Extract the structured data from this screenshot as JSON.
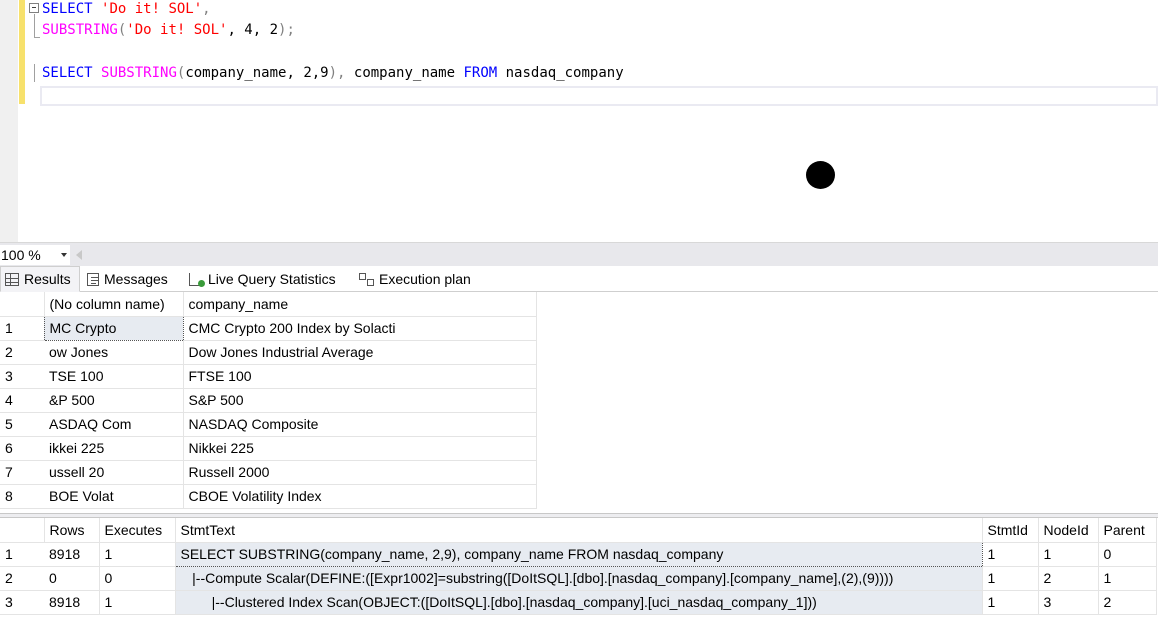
{
  "editor": {
    "lines": [
      {
        "tokens": [
          {
            "t": "SELECT",
            "c": "kw"
          },
          {
            "t": " "
          },
          {
            "t": "'Do it! SOL'",
            "c": "str"
          },
          {
            "t": ",",
            "c": "pun"
          }
        ]
      },
      {
        "tokens": [
          {
            "t": "SUBSTRING",
            "c": "fn"
          },
          {
            "t": "(",
            "c": "pun"
          },
          {
            "t": "'Do it! SOL'",
            "c": "str"
          },
          {
            "t": ", 4, 2",
            "c": ""
          },
          {
            "t": ");",
            "c": "pun"
          }
        ]
      },
      {
        "tokens": []
      },
      {
        "tokens": [
          {
            "t": "SELECT",
            "c": "kw"
          },
          {
            "t": " "
          },
          {
            "t": "SUBSTRING",
            "c": "fn"
          },
          {
            "t": "(",
            "c": "pun"
          },
          {
            "t": "company_name, 2,9"
          },
          {
            "t": "),",
            "c": "pun"
          },
          {
            "t": " company_name "
          },
          {
            "t": "FROM",
            "c": "kw"
          },
          {
            "t": " nasdaq_company"
          }
        ]
      }
    ]
  },
  "zoom": {
    "value": "100 %"
  },
  "tabs": [
    {
      "label": "Results",
      "icon": "grid-icon",
      "active": true
    },
    {
      "label": "Messages",
      "icon": "messages-icon"
    },
    {
      "label": "Live Query Statistics",
      "icon": "live-stats-icon"
    },
    {
      "label": "Execution plan",
      "icon": "execution-plan-icon"
    }
  ],
  "results": {
    "columns": [
      "(No column name)",
      "company_name"
    ],
    "rows": [
      [
        "1",
        "MC Crypto",
        "CMC Crypto 200 Index by Solacti"
      ],
      [
        "2",
        "ow Jones",
        "Dow Jones Industrial Average"
      ],
      [
        "3",
        "TSE 100",
        "FTSE 100"
      ],
      [
        "4",
        "&P 500",
        "S&P 500"
      ],
      [
        "5",
        "ASDAQ Com",
        "NASDAQ Composite"
      ],
      [
        "6",
        "ikkei 225",
        "Nikkei 225"
      ],
      [
        "7",
        "ussell 20",
        "Russell 2000"
      ],
      [
        "8",
        "BOE Volat",
        "CBOE Volatility Index"
      ]
    ]
  },
  "plan": {
    "columns": [
      "Rows",
      "Executes",
      "StmtText",
      "StmtId",
      "NodeId",
      "Parent"
    ],
    "rows": [
      [
        "1",
        "8918",
        "1",
        "SELECT SUBSTRING(company_name, 2,9), company_name FROM nasdaq_company",
        "1",
        "1",
        "0"
      ],
      [
        "2",
        "0",
        "0",
        "   |--Compute Scalar(DEFINE:([Expr1002]=substring([DoItSQL].[dbo].[nasdaq_company].[company_name],(2),(9))))",
        "1",
        "2",
        "1"
      ],
      [
        "3",
        "8918",
        "1",
        "        |--Clustered Index Scan(OBJECT:([DoItSQL].[dbo].[nasdaq_company].[uci_nasdaq_company_1]))",
        "1",
        "3",
        "2"
      ]
    ]
  }
}
